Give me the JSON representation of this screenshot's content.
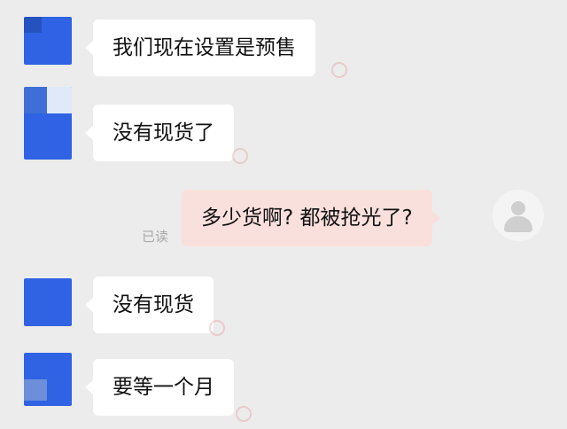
{
  "messages": [
    {
      "sender": "other",
      "text": "我们现在设置是预售"
    },
    {
      "sender": "other",
      "text": "没有现货了"
    },
    {
      "sender": "me",
      "text": "多少货啊? 都被抢光了?",
      "status": "已读"
    },
    {
      "sender": "other",
      "text": "没有现货"
    },
    {
      "sender": "other",
      "text": "要等一个月"
    }
  ],
  "colors": {
    "background": "#ececec",
    "incoming_bubble": "#ffffff",
    "outgoing_bubble": "#f9e0dc",
    "other_avatar": "#2f63e3",
    "read_status_text": "#a9a9a9"
  },
  "icons": {
    "self_avatar": "default-user-avatar-icon"
  }
}
